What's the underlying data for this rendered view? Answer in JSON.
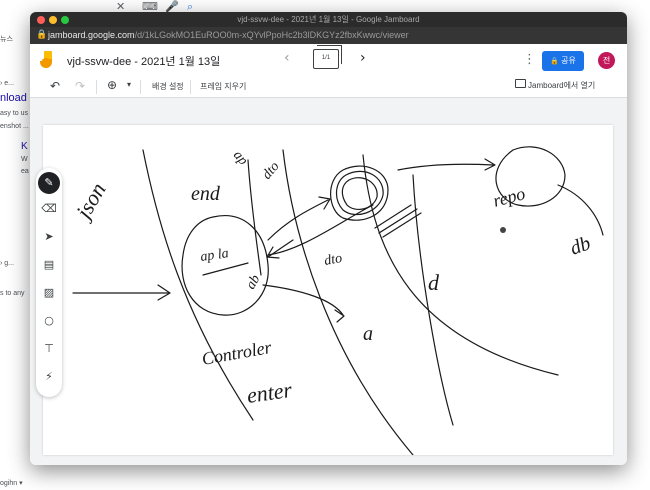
{
  "background_page": {
    "top_icons": [
      "close-icon",
      "keyboard-icon",
      "mic-icon",
      "search-icon"
    ],
    "snippets": [
      {
        "text": "뉴스"
      },
      {
        "text": "› e..."
      },
      {
        "text": "nload t"
      },
      {
        "text": "asy to us"
      },
      {
        "text": "enshot ..."
      },
      {
        "text": "K"
      },
      {
        "text": "W"
      },
      {
        "text": "ea"
      },
      {
        "text": "› g..."
      },
      {
        "text": "s to any"
      },
      {
        "text": "ogihn ▾"
      }
    ]
  },
  "window": {
    "title": "vjd-ssvw-dee - 2021년 1월 13일 - Google Jamboard",
    "url_host": "jamboard.google.com",
    "url_path": "/d/1kLGokMO1EuROO0m-xQYvlPpoHc2b3lDKGYz2fbxKwwc/viewer"
  },
  "header": {
    "doc_title": "vjd-ssvw-dee - 2021년 1월 13일",
    "frame_count": "1/1",
    "share_label": "공유",
    "avatar_initial": "전",
    "share_color": "#1a73e8",
    "avatar_color": "#c2185b"
  },
  "toolbar": {
    "background_label": "배경 설정",
    "clear_frame_label": "프레임 지우기",
    "open_in_jamboard_label": "Jamboard에서 열기"
  },
  "tools": [
    "pen-icon",
    "eraser-icon",
    "select-icon",
    "sticky-note-icon",
    "image-icon",
    "circle-shape-icon",
    "text-box-icon",
    "laser-icon"
  ],
  "ink_words": {
    "w1": "end",
    "w2": "ap la",
    "w3": "Controler",
    "w4": "enter",
    "w5": "ap",
    "w6": "ab",
    "w7": "d",
    "w8": "dto",
    "w9": "repo",
    "w10": "db",
    "w11": "a",
    "w12": "dto"
  }
}
